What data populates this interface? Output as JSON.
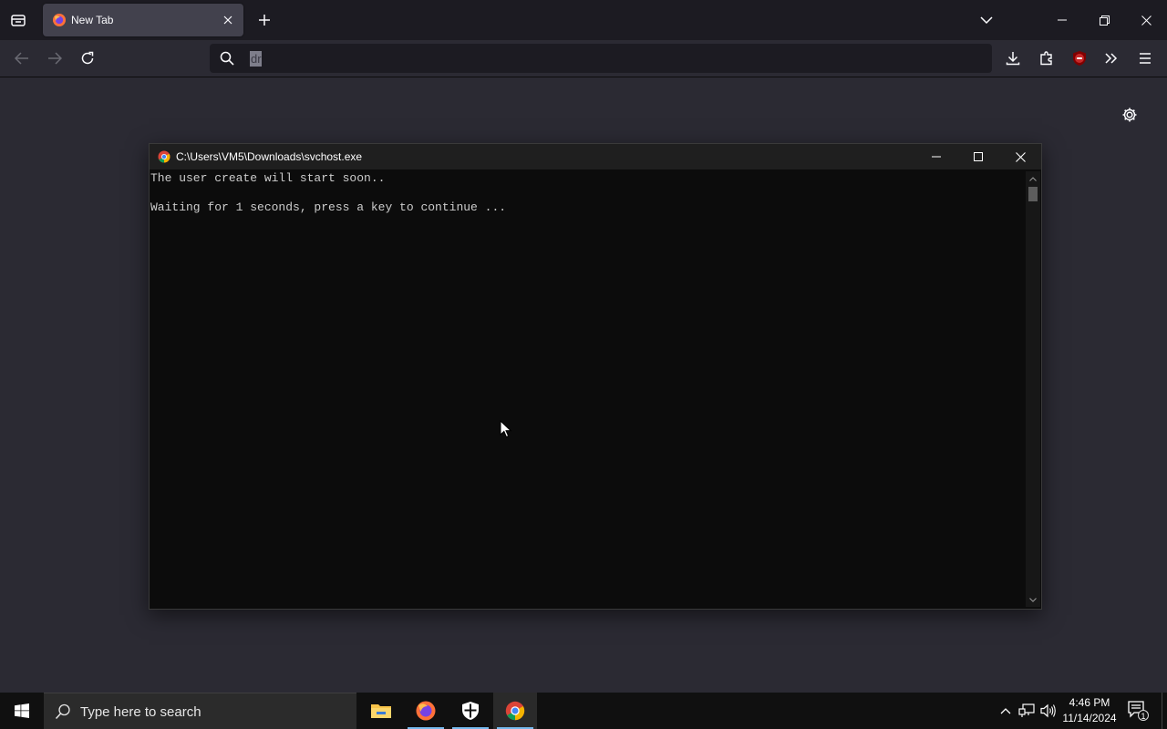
{
  "browser": {
    "tab": {
      "title": "New Tab"
    },
    "urlbar": {
      "value": "dr"
    }
  },
  "console": {
    "title": "C:\\Users\\VM5\\Downloads\\svchost.exe",
    "lines": [
      "The user create will start soon..",
      "Waiting for 1 seconds, press a key to continue ..."
    ]
  },
  "taskbar": {
    "search_placeholder": "Type here to search",
    "apps": [
      "file-explorer",
      "firefox",
      "security",
      "chrome"
    ],
    "clock": {
      "time": "4:46 PM",
      "date": "11/14/2024"
    },
    "notification_count": "1"
  },
  "colors": {
    "browser_chrome": "#1c1b22",
    "page_bg": "#2b2a33",
    "console_bg": "#0c0c0c",
    "taskbar_accent": "#76b9ed"
  }
}
